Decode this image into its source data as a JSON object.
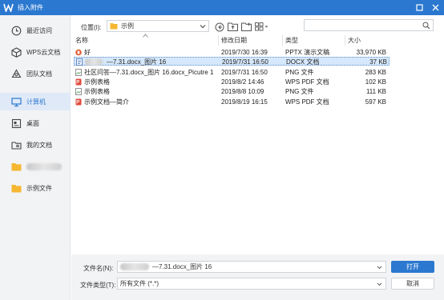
{
  "window": {
    "title": "插入附件",
    "accent": "#2b78d0"
  },
  "sidebar": {
    "items": [
      {
        "label": "最近访问",
        "icon": "clock-icon"
      },
      {
        "label": "WPS云文档",
        "icon": "cloud-box-icon"
      },
      {
        "label": "团队文档",
        "icon": "team-icon"
      },
      {
        "label": "计算机",
        "icon": "computer-icon",
        "active": true
      },
      {
        "label": "桌面",
        "icon": "desktop-icon"
      },
      {
        "label": "我的文档",
        "icon": "my-documents-icon"
      },
      {
        "label": "",
        "icon": "folder-icon",
        "redacted": true
      },
      {
        "label": "示例文件",
        "icon": "folder-icon"
      }
    ]
  },
  "location": {
    "label": "位置(I):",
    "value": "示例"
  },
  "columns": {
    "name": "名称",
    "modified": "修改日期",
    "type": "类型",
    "size": "大小"
  },
  "files": [
    {
      "icon": "pptx-file-icon",
      "name": "好",
      "modified": "2019/7/30 16:39",
      "type": "PPTX 演示文稿",
      "size": "33,970 KB",
      "name_redacted_prefix": false
    },
    {
      "icon": "docx-file-icon",
      "name": "—7.31.docx_图片 16",
      "modified": "2019/7/31 16:50",
      "type": "DOCX 文档",
      "size": "37 KB",
      "name_redacted_prefix": true,
      "selected": true
    },
    {
      "icon": "png-file-icon",
      "name": "社区问答—7.31.docx_图片 16.docx_Picutre 1",
      "modified": "2019/7/31 16:50",
      "type": "PNG 文件",
      "size": "283 KB",
      "name_redacted_prefix": false
    },
    {
      "icon": "pdf-file-icon",
      "name": "示例表格",
      "modified": "2019/8/2 14:46",
      "type": "WPS PDF 文档",
      "size": "102 KB",
      "name_redacted_prefix": false
    },
    {
      "icon": "png-file-icon",
      "name": "示例表格",
      "modified": "2019/8/8 10:09",
      "type": "PNG 文件",
      "size": "111 KB",
      "name_redacted_prefix": false
    },
    {
      "icon": "pdf-file-icon",
      "name": "示例文档—简介",
      "modified": "2019/8/19 16:15",
      "type": "WPS PDF 文档",
      "size": "597 KB",
      "name_redacted_prefix": false
    }
  ],
  "bottom": {
    "filename_label": "文件名(N):",
    "filename_value": "—7.31.docx_图片 16",
    "filetype_label": "文件类型(T):",
    "filetype_value": "所有文件 (*.*)",
    "open_label": "打开",
    "cancel_label": "取消"
  }
}
